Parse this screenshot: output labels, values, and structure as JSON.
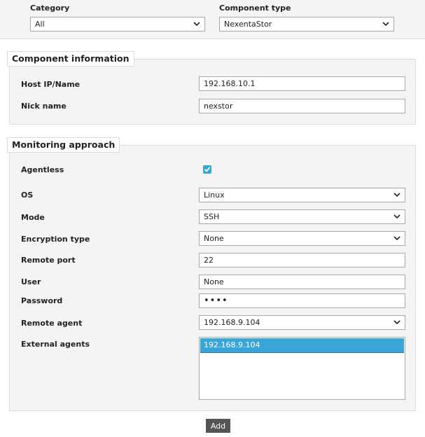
{
  "filters": {
    "category_label": "Category",
    "category_value": "All",
    "component_type_label": "Component type",
    "component_type_value": "NexentaStor"
  },
  "component_info": {
    "legend": "Component information",
    "host_label": "Host IP/Name",
    "host_value": "192.168.10.1",
    "nick_label": "Nick name",
    "nick_value": "nexstor"
  },
  "monitoring": {
    "legend": "Monitoring approach",
    "agentless_label": "Agentless",
    "agentless_checked": true,
    "os_label": "OS",
    "os_value": "Linux",
    "mode_label": "Mode",
    "mode_value": "SSH",
    "encryption_label": "Encryption type",
    "encryption_value": "None",
    "port_label": "Remote port",
    "port_value": "22",
    "user_label": "User",
    "user_value": "None",
    "password_label": "Password",
    "password_value": "••••",
    "remote_agent_label": "Remote agent",
    "remote_agent_value": "192.168.9.104",
    "external_agents_label": "External agents",
    "external_agents_items": [
      "192.168.9.104"
    ]
  },
  "actions": {
    "add_label": "Add"
  },
  "colors": {
    "accent": "#3aa6d8",
    "button": "#555555",
    "panel": "#f4f4f4"
  }
}
